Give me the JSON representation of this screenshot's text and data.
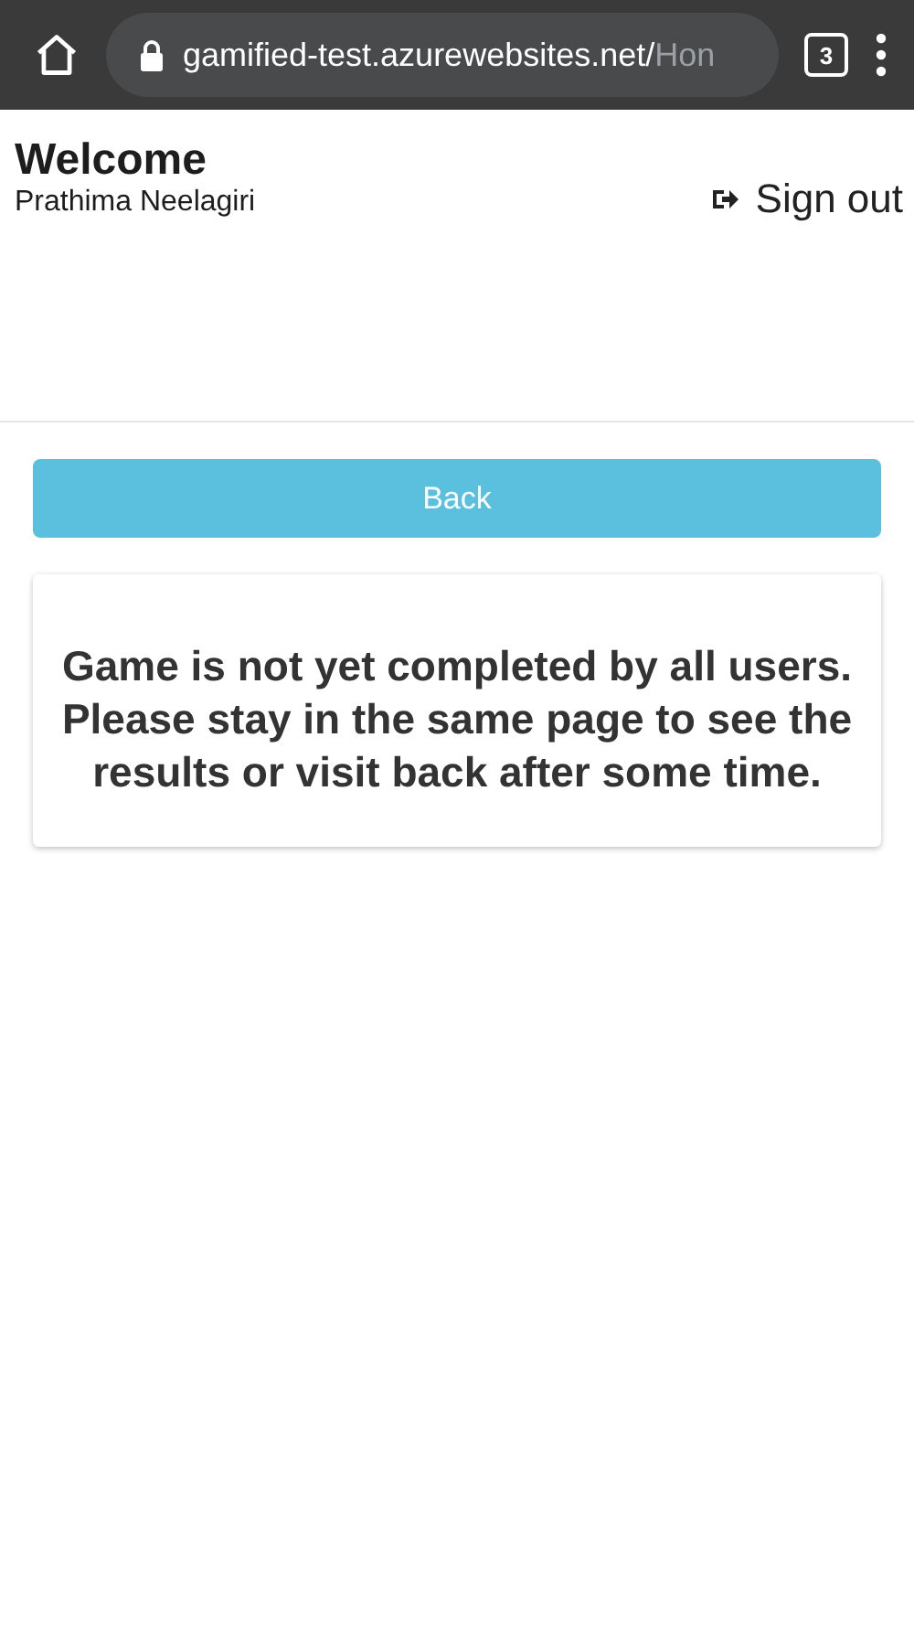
{
  "browser": {
    "url_host": "gamified-test.azurewebsites.net/",
    "url_path": "Hon",
    "tab_count": "3"
  },
  "header": {
    "title": "Welcome",
    "user": "Prathima Neelagiri",
    "sign_out": "Sign out"
  },
  "back_button": "Back",
  "message": "Game is not yet completed by all users. Please stay in the same page to see the results or visit back after some time."
}
